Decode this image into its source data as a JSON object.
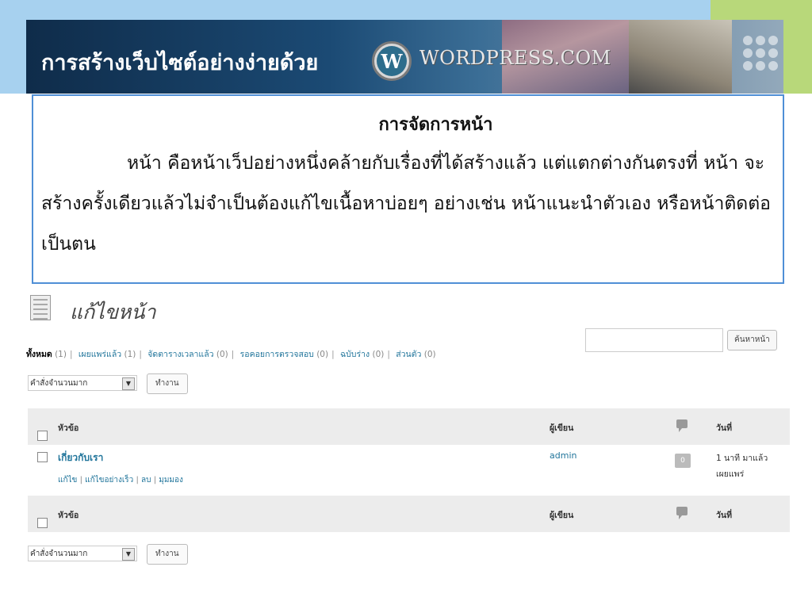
{
  "slide": {
    "banner_title": "การสร้างเว็บไซต์อย่างง่ายด้วย",
    "wp_logo_letter": "W",
    "wp_wordmark": "WORDPRESS.COM",
    "box_title": "การจัดการหน้า",
    "box_paragraph": "หน้า คือหน้าเว็ปอย่างหนึ่งคล้ายกับเรื่องที่ได้สร้างแล้ว แต่แตกต่างกันตรงที่ หน้า จะสร้างครั้งเดียวแล้วไม่จำเป็นต้องแก้ไขเนื้อหาบ่อยๆ อย่างเช่น หน้าแนะนำตัวเอง หรือหน้าติดต่อเป็นตน"
  },
  "admin": {
    "page_title": "แก้ไขหน้า",
    "filters": {
      "all_label": "ทั้งหมด",
      "all_count": "(1)",
      "published_label": "เผยแพร่แล้ว",
      "published_count": "(1)",
      "scheduled_label": "จัดตารางเวลาแล้ว",
      "scheduled_count": "(0)",
      "pending_label": "รอคอยการตรวจสอบ",
      "pending_count": "(0)",
      "draft_label": "ฉบับร่าง",
      "draft_count": "(0)",
      "private_label": "ส่วนตัว",
      "private_count": "(0)"
    },
    "search_button": "ค้นหาหน้า",
    "bulk_select": "คำสั่งจำนวนมาก",
    "apply_button": "ทำงาน",
    "columns": {
      "title": "หัวข้อ",
      "author": "ผู้เขียน",
      "date": "วันที่"
    },
    "rows": [
      {
        "title": "เกี่ยวกับเรา",
        "actions": [
          "แก้ไข",
          "แก้ไขอย่างเร็ว",
          "ลบ",
          "มุมมอง"
        ],
        "author": "admin",
        "comments": "0",
        "date_line1": "1 นาที มาแล้ว",
        "date_line2": "เผยแพร่"
      }
    ]
  },
  "colors": {
    "link": "#21759b",
    "header_bg": "#ececec",
    "box_border": "#4f8fd6"
  }
}
